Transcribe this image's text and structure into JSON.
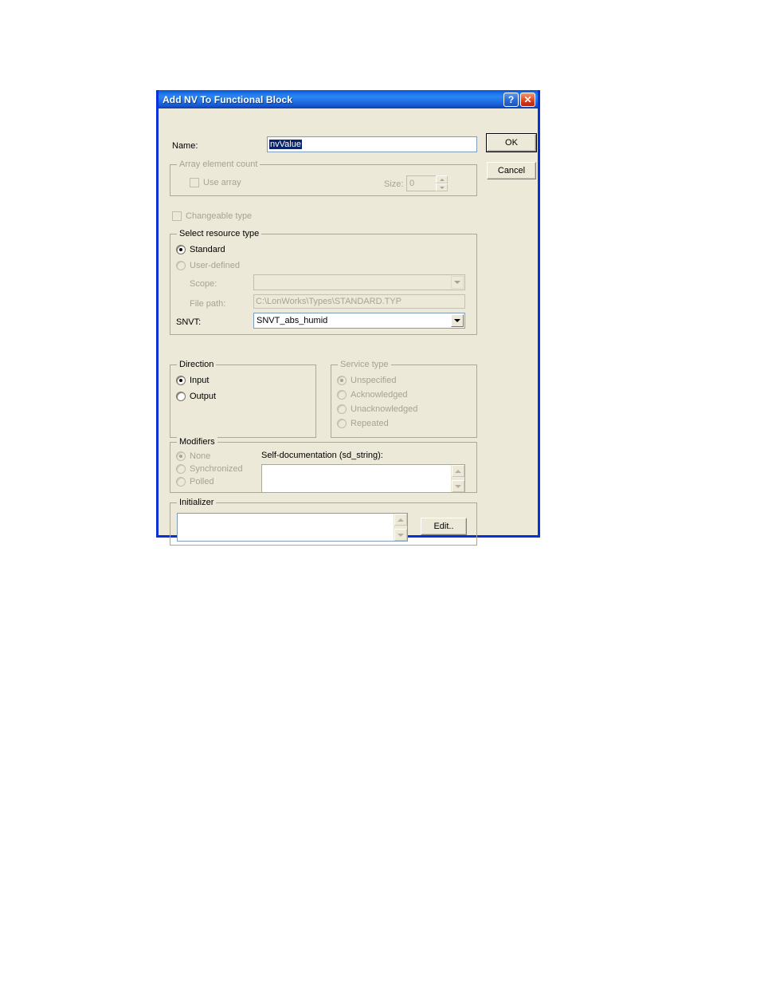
{
  "window": {
    "title": "Add NV To Functional Block",
    "help_button": "?",
    "close_button": "✕"
  },
  "name_row": {
    "label": "Name:",
    "value": "nvValue",
    "selected": true
  },
  "buttons": {
    "ok": "OK",
    "cancel": "Cancel",
    "edit": "Edit.."
  },
  "array_group": {
    "title": "Array element count",
    "use_array_label": "Use array",
    "use_array_checked": false,
    "size_label": "Size:",
    "size_value": "0",
    "enabled": false
  },
  "changeable_type": {
    "label": "Changeable type",
    "checked": false,
    "enabled": false
  },
  "resource_group": {
    "title": "Select resource type",
    "standard_label": "Standard",
    "standard_selected": true,
    "user_defined_label": "User-defined",
    "user_defined_selected": false,
    "scope_label": "Scope:",
    "scope_value": "",
    "file_path_label": "File path:",
    "file_path_value": "C:\\LonWorks\\Types\\STANDARD.TYP",
    "snvt_label": "SNVT:",
    "snvt_value": "SNVT_abs_humid"
  },
  "direction_group": {
    "title": "Direction",
    "options": [
      {
        "label": "Input",
        "selected": true
      },
      {
        "label": "Output",
        "selected": false
      }
    ]
  },
  "service_group": {
    "title": "Service type",
    "enabled": false,
    "options": [
      {
        "label": "Unspecified",
        "selected": true
      },
      {
        "label": "Acknowledged",
        "selected": false
      },
      {
        "label": "Unacknowledged",
        "selected": false
      },
      {
        "label": "Repeated",
        "selected": false
      }
    ]
  },
  "modifiers_group": {
    "title": "Modifiers",
    "enabled": false,
    "options": [
      {
        "label": "None",
        "selected": true
      },
      {
        "label": "Synchronized",
        "selected": false
      },
      {
        "label": "Polled",
        "selected": false
      }
    ],
    "sd_label": "Self-documentation (sd_string):",
    "sd_value": ""
  },
  "initializer_group": {
    "title": "Initializer",
    "value": ""
  },
  "colors": {
    "dialog_face": "#ece9d8",
    "title_blue": "#0831d9",
    "selection_blue": "#0a246a",
    "field_border": "#7f9db9",
    "disabled_text": "#a8a296"
  }
}
